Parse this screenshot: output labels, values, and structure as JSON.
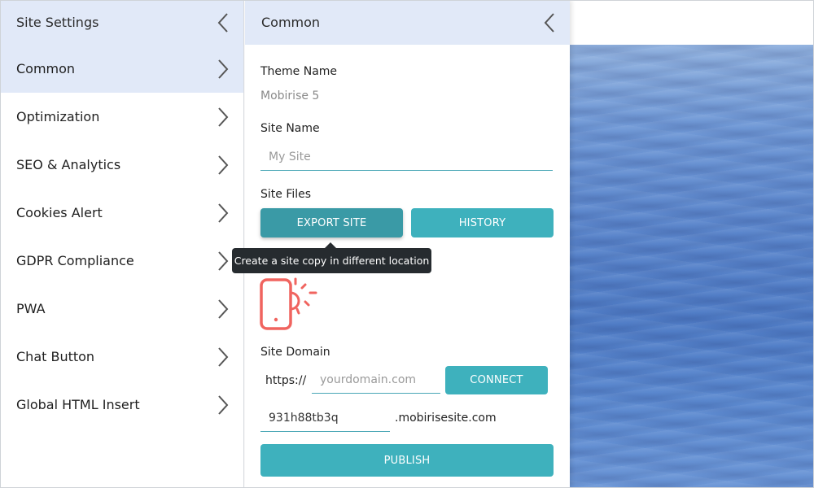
{
  "left_panel": {
    "title": "Site Settings",
    "items": [
      {
        "label": "Common"
      },
      {
        "label": "Optimization"
      },
      {
        "label": "SEO & Analytics"
      },
      {
        "label": "Cookies Alert"
      },
      {
        "label": "GDPR Compliance"
      },
      {
        "label": "PWA"
      },
      {
        "label": "Chat Button"
      },
      {
        "label": "Global HTML Insert"
      }
    ]
  },
  "common_panel": {
    "title": "Common",
    "theme_name_label": "Theme Name",
    "theme_name_value": "Mobirise 5",
    "site_name_label": "Site Name",
    "site_name_placeholder": "My Site",
    "site_files_label": "Site Files",
    "export_button": "EXPORT SITE",
    "history_button": "HISTORY",
    "export_tooltip": "Create a site copy in different location",
    "site_domain_label": "Site Domain",
    "protocol_prefix": "https://",
    "domain_placeholder": "yourdomain.com",
    "connect_button": "CONNECT",
    "subdomain_value": "931h88tb3q",
    "subdomain_suffix": ".mobirisesite.com",
    "publish_button": "PUBLISH"
  },
  "colors": {
    "header_bg": "#e1e9f8",
    "accent_teal": "#3eb1bd",
    "icon_coral": "#f0645f",
    "tooltip_bg": "#262b2f"
  },
  "icons": {
    "chevron_right": "chevron-right-icon",
    "chevron_left": "chevron-left-icon",
    "phone_sun": "phone-brightness-icon"
  }
}
